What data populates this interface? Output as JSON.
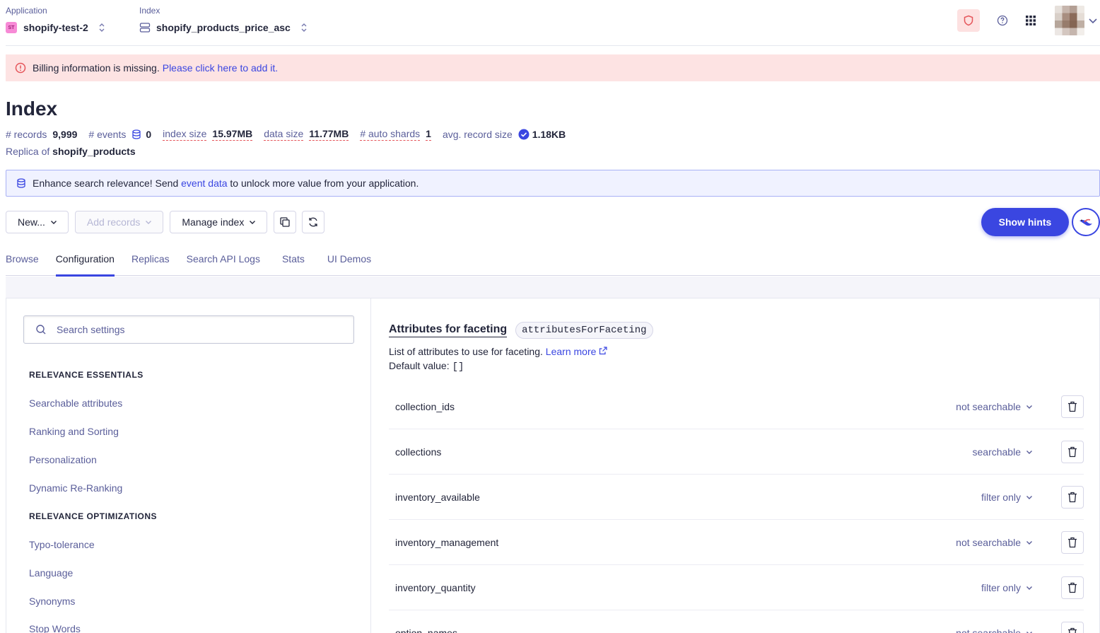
{
  "header": {
    "application_label": "Application",
    "application_badge": "ST",
    "application_name": "shopify-test-2",
    "index_label": "Index",
    "index_name": "shopify_products_price_asc"
  },
  "billing_alert": {
    "message": "Billing information is missing.",
    "link": "Please click here to add it."
  },
  "page": {
    "title": "Index",
    "stats": [
      {
        "key": "# records",
        "value": "9,999"
      },
      {
        "key": "# events",
        "value": "0"
      },
      {
        "key": "index size",
        "value": "15.97MB"
      },
      {
        "key": "data size",
        "value": "11.77MB"
      },
      {
        "key": "# auto shards",
        "value": "1"
      },
      {
        "key": "avg. record size",
        "value": "1.18KB"
      }
    ],
    "replica_prefix": "Replica of",
    "replica_of": "shopify_products"
  },
  "banner": {
    "before": "Enhance search relevance! Send",
    "link": "event data",
    "after": "to unlock more value from your application."
  },
  "toolbar": {
    "new_label": "New...",
    "add_records_label": "Add records",
    "manage_index_label": "Manage index",
    "show_hints_label": "Show hints"
  },
  "tabs": [
    {
      "label": "Browse",
      "active": false
    },
    {
      "label": "Configuration",
      "active": true
    },
    {
      "label": "Replicas",
      "active": false
    },
    {
      "label": "Search API Logs",
      "active": false
    },
    {
      "label": "Stats",
      "active": false
    },
    {
      "label": "UI Demos",
      "active": false
    }
  ],
  "sidebar": {
    "search_placeholder": "Search settings",
    "sections": [
      {
        "heading": "RELEVANCE ESSENTIALS",
        "items": [
          "Searchable attributes",
          "Ranking and Sorting",
          "Personalization",
          "Dynamic Re-Ranking"
        ]
      },
      {
        "heading": "RELEVANCE OPTIMIZATIONS",
        "items": [
          "Typo-tolerance",
          "Language",
          "Synonyms",
          "Stop Words"
        ]
      }
    ]
  },
  "detail": {
    "title": "Attributes for faceting",
    "setting_key": "attributesForFaceting",
    "description": "List of attributes to use for faceting.",
    "learn_more": "Learn more",
    "default_label": "Default value:",
    "default_value": "[]",
    "facets": [
      {
        "name": "collection_ids",
        "mode": "not searchable"
      },
      {
        "name": "collections",
        "mode": "searchable"
      },
      {
        "name": "inventory_available",
        "mode": "filter only"
      },
      {
        "name": "inventory_management",
        "mode": "not searchable"
      },
      {
        "name": "inventory_quantity",
        "mode": "filter only"
      },
      {
        "name": "option_names",
        "mode": "not searchable"
      }
    ]
  },
  "colors": {
    "accent": "#3a46e1",
    "alert_bg": "#fde3e3",
    "alert_icon": "#e5555a",
    "banner_bg": "#f0f2ff"
  },
  "icons": {
    "alert": "error-circle-icon",
    "banner": "database-icon",
    "shield": "shield-icon",
    "help": "help-circle-icon",
    "apps": "grid-icon",
    "search": "search-icon",
    "delete": "trash-icon"
  }
}
